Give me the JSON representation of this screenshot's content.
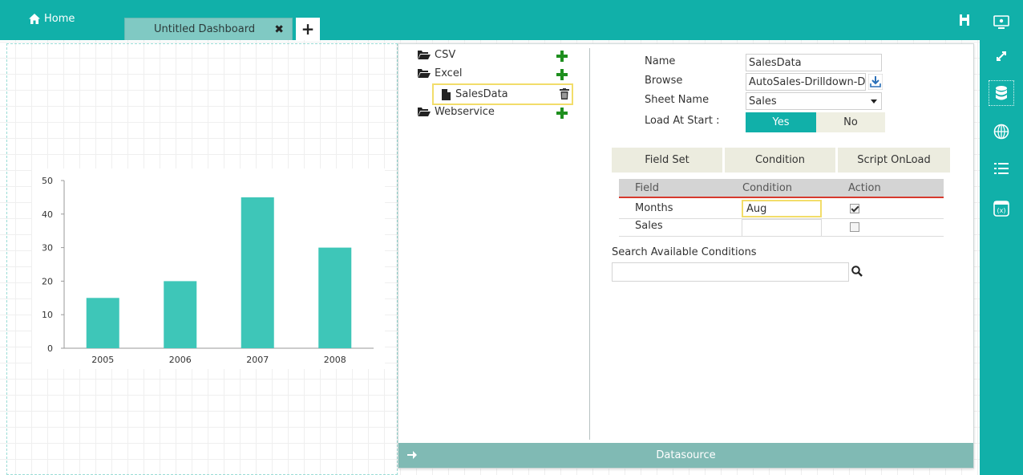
{
  "header": {
    "home_label": "Home",
    "tab_label": "Untitled Dashboard",
    "tab_close_glyph": "✖",
    "add_tab_glyph": "+"
  },
  "sidebar": {
    "icons": [
      "preview-icon",
      "expand-icon",
      "database-icon",
      "globe-icon",
      "list-icon",
      "function-window-icon"
    ],
    "active": "database-icon"
  },
  "chart_data": {
    "type": "bar",
    "categories": [
      "2005",
      "2006",
      "2007",
      "2008"
    ],
    "values": [
      15,
      20,
      45,
      30
    ],
    "title": "",
    "xlabel": "",
    "ylabel": "",
    "ylim": [
      0,
      50
    ],
    "yticks": [
      "0",
      "10",
      "20",
      "30",
      "40",
      "50"
    ],
    "color": "#3ec6b8"
  },
  "datasource": {
    "tree": {
      "csv": "CSV",
      "excel": "Excel",
      "excel_child": "SalesData",
      "webservice": "Webservice"
    },
    "form": {
      "name_label": "Name",
      "name_value": "SalesData",
      "browse_label": "Browse",
      "browse_value": "AutoSales-Drilldown-D",
      "sheet_label": "Sheet Name",
      "sheet_value": "Sales",
      "load_label": "Load At Start :",
      "yes_label": "Yes",
      "no_label": "No"
    },
    "subtabs": [
      "Field Set",
      "Condition",
      "Script OnLoad"
    ],
    "table": {
      "headers": [
        "Field",
        "Condition",
        "Action"
      ],
      "rows": [
        {
          "field": "Months",
          "condition": "Aug",
          "checked": true
        },
        {
          "field": "Sales",
          "condition": "",
          "checked": false
        }
      ]
    },
    "search_label": "Search Available Conditions",
    "footer_label": "Datasource"
  },
  "colors": {
    "accent": "#11b0a9",
    "highlight": "#f2dd6a",
    "bar": "#3ec6b8",
    "plus": "#1e8f1e"
  }
}
